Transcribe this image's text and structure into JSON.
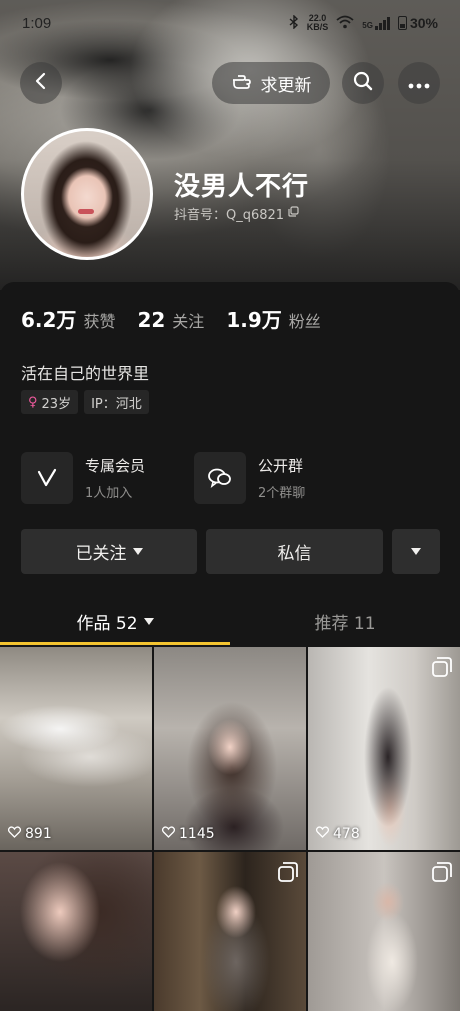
{
  "status_bar": {
    "time": "1:09",
    "net_speed_value": "22.0",
    "net_speed_unit": "KB/S",
    "signal_label": "5G",
    "battery": "30%",
    "icons": [
      "bluetooth-icon",
      "wifi-icon",
      "signal-icon",
      "battery-icon"
    ]
  },
  "top_nav": {
    "update_label": "求更新",
    "icons": [
      "back-icon",
      "hand-point-icon",
      "search-icon",
      "more-icon"
    ]
  },
  "profile": {
    "name": "没男人不行",
    "id_label": "抖音号：Q_q6821",
    "stats": [
      {
        "num": "6.2万",
        "label": "获赞"
      },
      {
        "num": "22",
        "label": "关注"
      },
      {
        "num": "1.9万",
        "label": "粉丝"
      }
    ],
    "bio": "活在自己的世界里",
    "tags": {
      "age": "23岁",
      "ip": "IP：河北"
    }
  },
  "features": [
    {
      "title": "专属会员",
      "sub": "1人加入",
      "icon": "vip-v-icon"
    },
    {
      "title": "公开群",
      "sub": "2个群聊",
      "icon": "group-chat-icon"
    }
  ],
  "actions": {
    "follow_label": "已关注",
    "message_label": "私信"
  },
  "tabs": [
    {
      "label": "作品 52",
      "active": true
    },
    {
      "label": "推荐 11",
      "active": false
    }
  ],
  "videos": [
    {
      "likes": "891",
      "multi": false
    },
    {
      "likes": "1145",
      "multi": false
    },
    {
      "likes": "478",
      "multi": true
    },
    {
      "likes": "",
      "multi": false
    },
    {
      "likes": "",
      "multi": true
    },
    {
      "likes": "",
      "multi": true
    }
  ],
  "colors": {
    "accent_underline": "#f4c431",
    "background": "#161616",
    "female_tag": "#f05a9e"
  }
}
